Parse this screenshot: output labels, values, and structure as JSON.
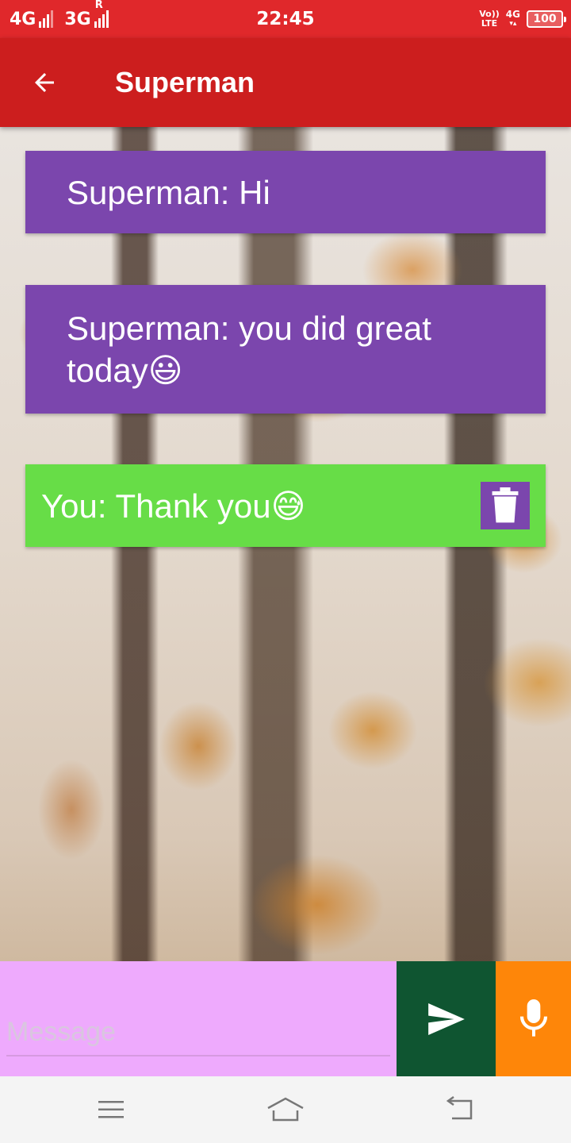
{
  "status_bar": {
    "network_1": "4G",
    "network_2": "3G",
    "roaming_mark": "R",
    "time": "22:45",
    "volte_line1": "Vo))",
    "volte_line2": "LTE",
    "data_type": "4G",
    "battery": "100"
  },
  "app_bar": {
    "title": "Superman",
    "back_icon": "arrow-back-icon"
  },
  "messages": [
    {
      "type": "received",
      "text": "Superman: Hi",
      "emoji": ""
    },
    {
      "type": "received",
      "text": "Superman: you did great today",
      "emoji": "😃"
    },
    {
      "type": "sent",
      "text": "You: Thank you",
      "emoji": "😅",
      "action_icon": "trash-icon"
    }
  ],
  "composer": {
    "placeholder": "Message",
    "value": "",
    "send_icon": "send-icon",
    "mic_icon": "microphone-icon"
  },
  "nav_bar": {
    "menu_icon": "menu-icon",
    "home_icon": "home-icon",
    "back_icon": "back-icon"
  },
  "colors": {
    "status_bar": "#e0282b",
    "app_bar": "#cc1e1e",
    "received_bubble": "#7b46ad",
    "sent_bubble": "#67dd47",
    "input_background": "#eeaafd",
    "send_button": "#0f5531",
    "mic_button": "#fe8609"
  }
}
